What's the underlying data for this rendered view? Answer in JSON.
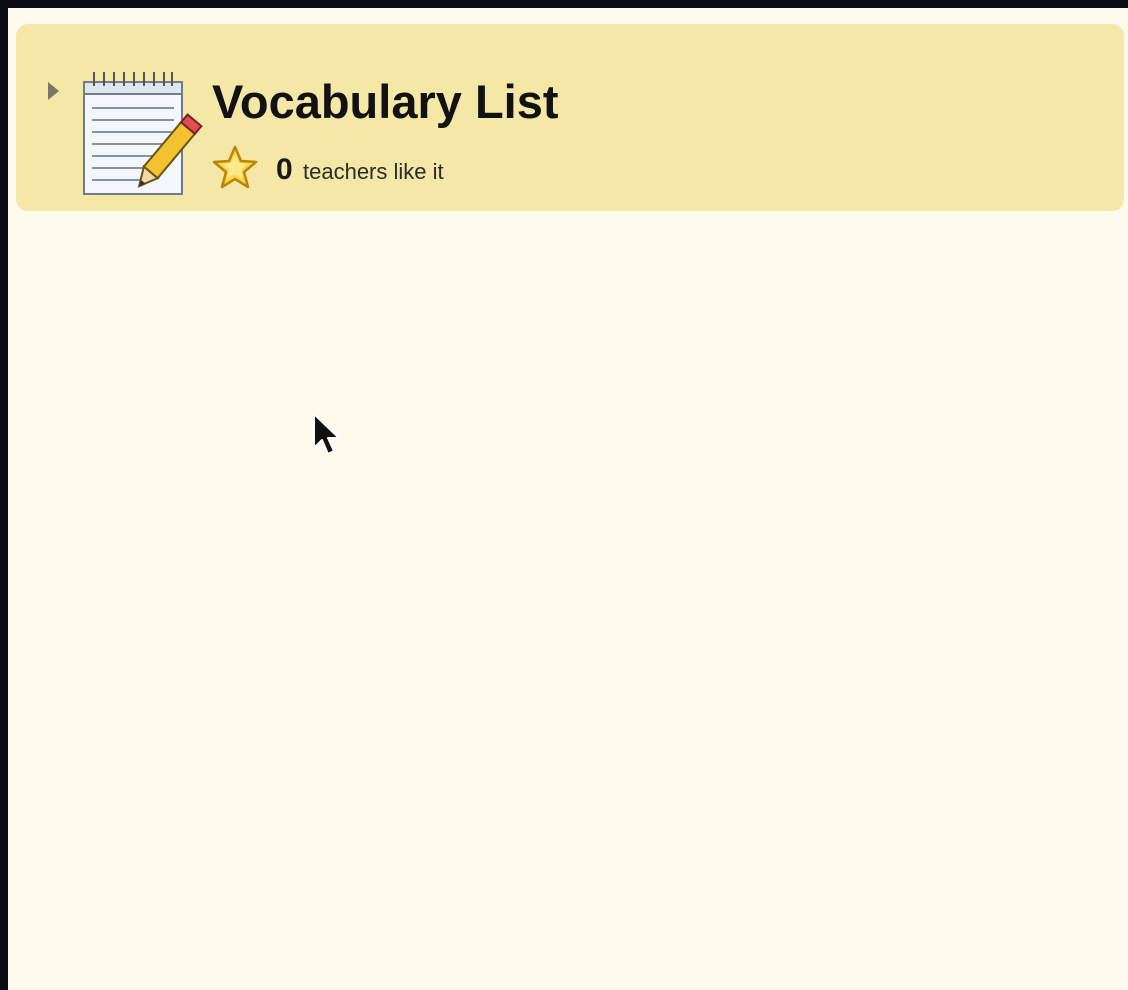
{
  "colors": {
    "page_background": "#fffbec",
    "header_background": "#f5e7a6",
    "outer_background": "#0b0b14"
  },
  "header": {
    "title": "Vocabulary List",
    "icon": "notepad-pencil-icon",
    "toggle_icon": "expand-triangle-icon"
  },
  "likes": {
    "icon": "star-icon",
    "count": "0",
    "label": "teachers like it"
  },
  "pointer": {
    "icon": "mouse-cursor-icon"
  }
}
